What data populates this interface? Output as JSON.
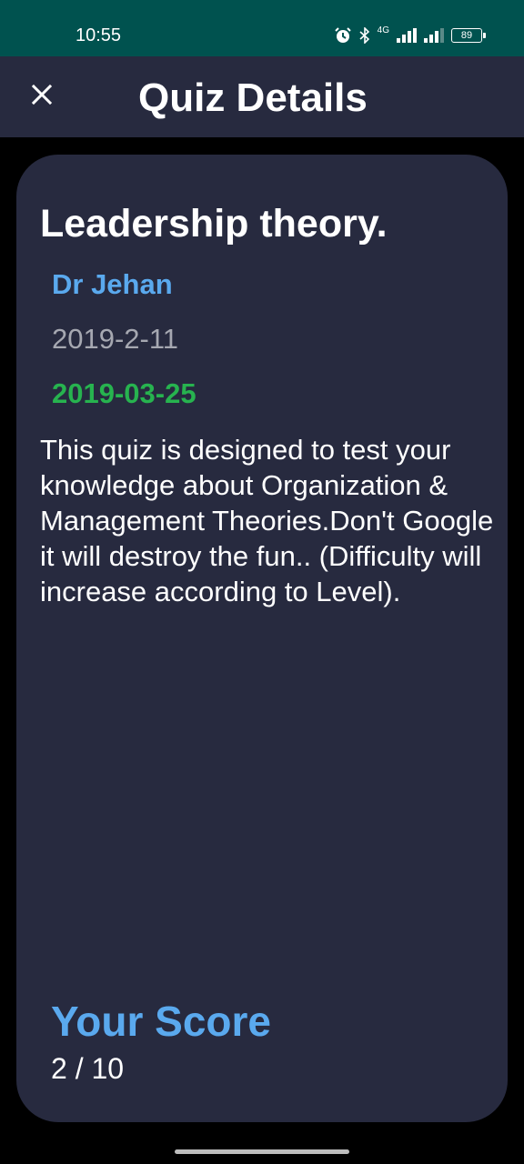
{
  "status_bar": {
    "time": "10:55",
    "network": "4G",
    "battery": "89",
    "icons": [
      "alarm-icon",
      "bluetooth-icon",
      "signal-icon",
      "signal-icon",
      "battery-icon"
    ]
  },
  "app_bar": {
    "title": "Quiz Details",
    "close_icon": "close-icon"
  },
  "quiz": {
    "title": "Leadership theory.",
    "author": "Dr Jehan",
    "start_date": "2019-2-11",
    "end_date": "2019-03-25",
    "description": "This quiz is designed to test your knowledge about Organization & Management Theories.Don't Google it will destroy the fun.. (Difficulty will increase according to Level)."
  },
  "score": {
    "label": "Your Score",
    "value": "2 / 10"
  },
  "colors": {
    "status_bar": "#00524f",
    "surface": "#272a3f",
    "accent_blue": "#5aa9ee",
    "accent_green": "#27b34f",
    "muted_text": "#a6a8b1"
  }
}
